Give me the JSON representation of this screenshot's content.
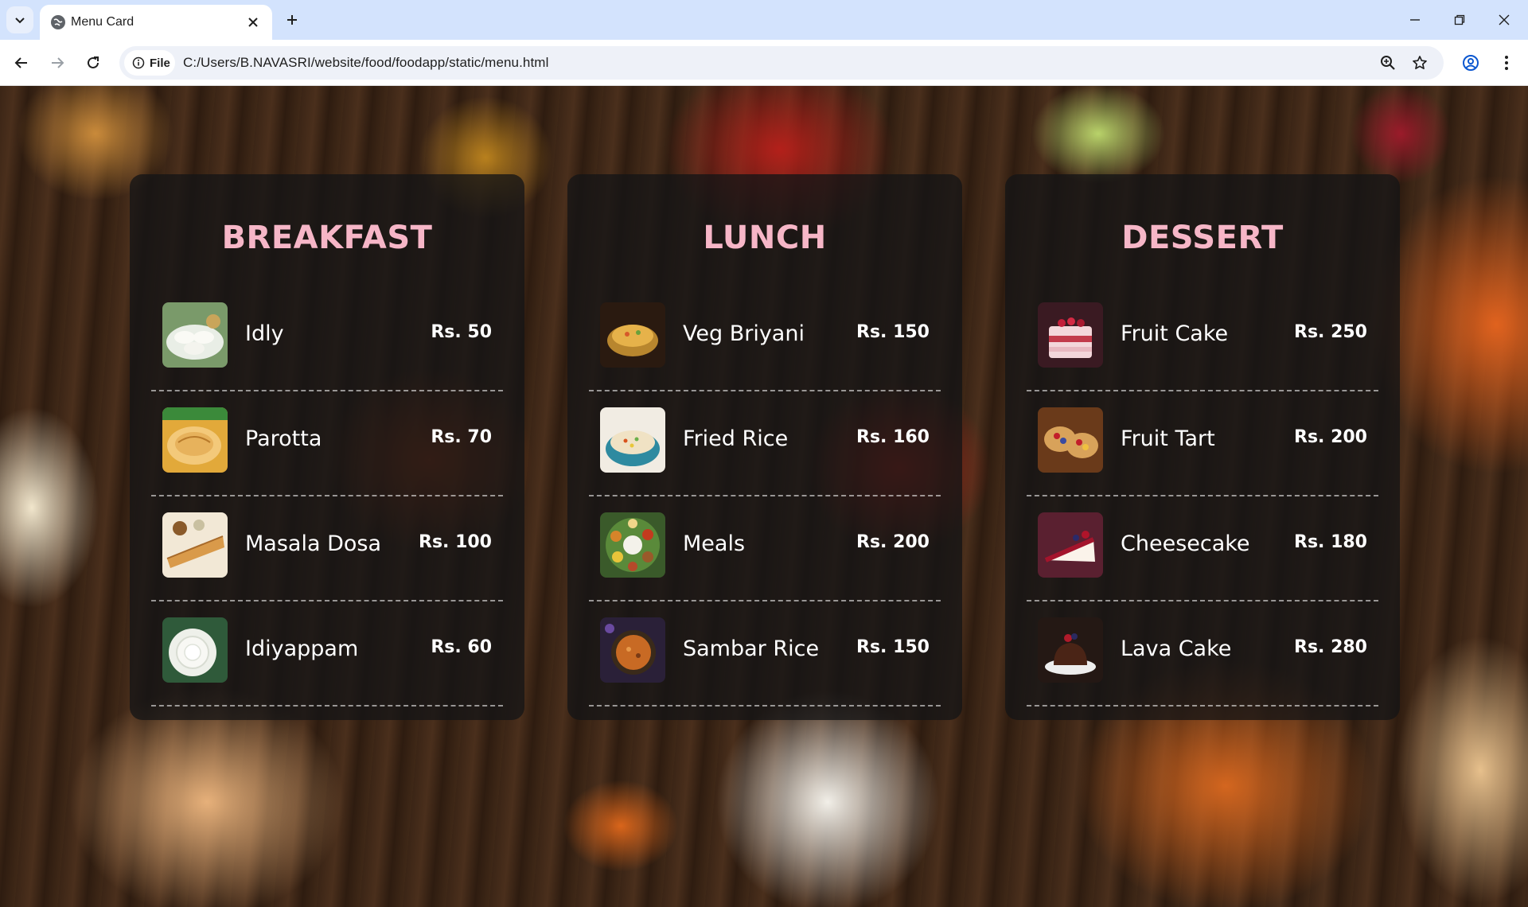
{
  "browser": {
    "tab_title": "Menu Card",
    "url_chip_label": "File",
    "url": "C:/Users/B.NAVASRI/website/food/foodapp/static/menu.html"
  },
  "menu": {
    "sections": [
      {
        "title": "BREAKFAST",
        "items": [
          {
            "name": "Idly",
            "price": "Rs. 50"
          },
          {
            "name": "Parotta",
            "price": "Rs. 70"
          },
          {
            "name": "Masala Dosa",
            "price": "Rs. 100"
          },
          {
            "name": "Idiyappam",
            "price": "Rs. 60"
          }
        ]
      },
      {
        "title": "LUNCH",
        "items": [
          {
            "name": "Veg Briyani",
            "price": "Rs. 150"
          },
          {
            "name": "Fried Rice",
            "price": "Rs. 160"
          },
          {
            "name": "Meals",
            "price": "Rs. 200"
          },
          {
            "name": "Sambar Rice",
            "price": "Rs. 150"
          }
        ]
      },
      {
        "title": "DESSERT",
        "items": [
          {
            "name": "Fruit Cake",
            "price": "Rs. 250"
          },
          {
            "name": "Fruit Tart",
            "price": "Rs. 200"
          },
          {
            "name": "Cheesecake",
            "price": "Rs. 180"
          },
          {
            "name": "Lava Cake",
            "price": "Rs. 280"
          }
        ]
      }
    ]
  },
  "colors": {
    "section_title": "#f6b6c7",
    "card_background": "rgba(20,20,22,0.78)",
    "tabbar": "#d3e3fd"
  }
}
